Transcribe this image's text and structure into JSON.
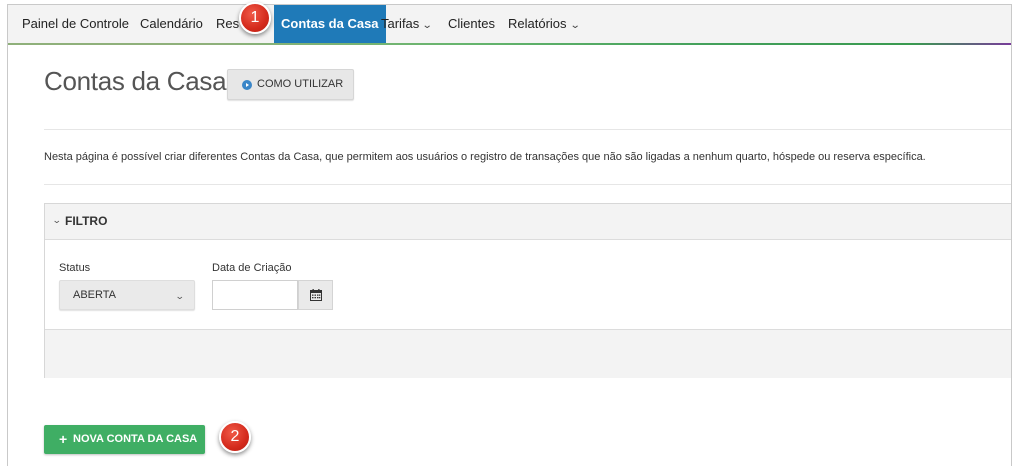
{
  "nav": {
    "items": [
      {
        "label": "Painel de Controle"
      },
      {
        "label": "Calendário"
      },
      {
        "label": "Res"
      },
      {
        "label": "Contas da Casa"
      },
      {
        "label": "Tarifas"
      },
      {
        "label": "Clientes"
      },
      {
        "label": "Relatórios"
      }
    ],
    "chevron": "⌄"
  },
  "markers": {
    "step1": "1",
    "step2": "2"
  },
  "page": {
    "title": "Contas da Casa",
    "how_to_button": "COMO UTILIZAR",
    "description": "Nesta página é possível criar diferentes Contas da Casa, que permitem aos usuários o registro de transações que não são ligadas a nenhum quarto, hóspede ou reserva específica."
  },
  "filter": {
    "title": "FILTRO",
    "status_label": "Status",
    "status_value": "ABERTA",
    "date_label": "Data de Criação",
    "date_value": ""
  },
  "actions": {
    "new_account": "NOVA CONTA DA CASA"
  },
  "icons": [
    "play-circle-icon",
    "calendar-icon",
    "plus-icon",
    "chevron-down-icon"
  ],
  "colors": {
    "active_tab": "#1f7ab8",
    "primary_green": "#3fae64",
    "marker_red": "#d42a1c",
    "info_blue": "#3a86c8"
  }
}
